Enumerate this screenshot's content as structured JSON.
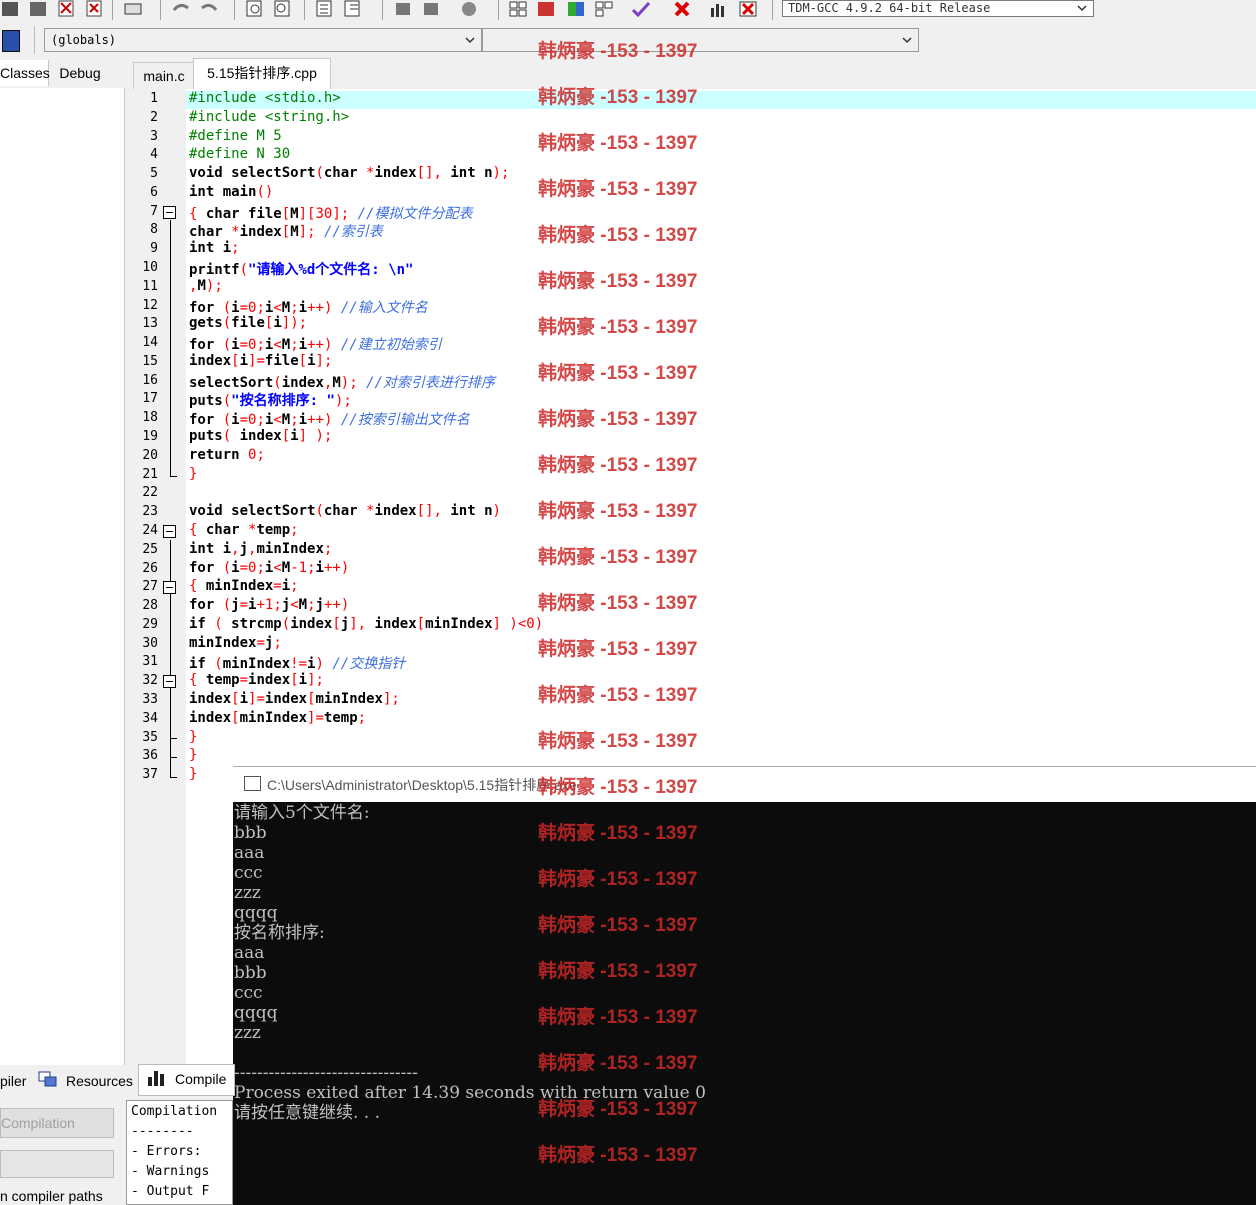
{
  "toolbar": {
    "compiler": "TDM-GCC 4.9.2 64-bit Release"
  },
  "scope": {
    "globals": "(globals)"
  },
  "left_tabs": [
    "Classes",
    "Debug"
  ],
  "file_tabs": [
    "main.c",
    "5.15指针排序.cpp"
  ],
  "watermark": "韩炳豪 -153 - 1397",
  "code_lines": [
    "#include <stdio.h>",
    "#include <string.h>",
    "#define M 5",
    "#define N 30",
    "void selectSort(char *index[], int n);",
    "int main()",
    "{ char file[M][30]; //模拟文件分配表",
    "char *index[M]; //索引表",
    "int i;",
    "printf(\"请输入%d个文件名: \\n\"",
    ",M);",
    "for (i=0;i<M;i++) //输入文件名",
    "gets(file[i]);",
    "for (i=0;i<M;i++) //建立初始索引",
    "index[i]=file[i];",
    "selectSort(index,M); //对索引表进行排序",
    "puts(\"按名称排序: \");",
    "for (i=0;i<M;i++) //按索引输出文件名",
    "puts( index[i] );",
    "return 0;",
    "}",
    "",
    "void selectSort(char *index[], int n)",
    "{ char *temp;",
    "int i,j,minIndex;",
    "for (i=0;i<M-1;i++)",
    "{ minIndex=i;",
    "for (j=i+1;j<M;j++)",
    "if ( strcmp(index[j], index[minIndex] )<0)",
    "minIndex=j;",
    "if (minIndex!=i) //交换指针",
    "{ temp=index[i];",
    "index[i]=index[minIndex];",
    "index[minIndex]=temp;",
    "}",
    "}",
    "}"
  ],
  "console": {
    "title": "C:\\Users\\Administrator\\Desktop\\5.15指针排序.exe",
    "lines": [
      "请输入5个文件名:",
      "bbb",
      "aaa",
      "ccc",
      "zzz",
      "qqqq",
      "按名称排序:",
      "aaa",
      "bbb",
      "ccc",
      "qqqq",
      "zzz",
      "",
      "--------------------------------",
      "Process exited after 14.39 seconds with return value 0",
      "请按任意键继续. . ."
    ]
  },
  "bottom": {
    "tabs": [
      "piler",
      "Resources",
      "Compile"
    ],
    "compilation_button": "Compilation",
    "paths_label": "n compiler paths",
    "log": [
      "Compilation",
      "--------",
      "- Errors:",
      "- Warnings",
      "- Output F"
    ]
  },
  "colors": {
    "highlight": "#ccffff",
    "console_bg": "#0c0c0c",
    "watermark": "#cd2828"
  }
}
